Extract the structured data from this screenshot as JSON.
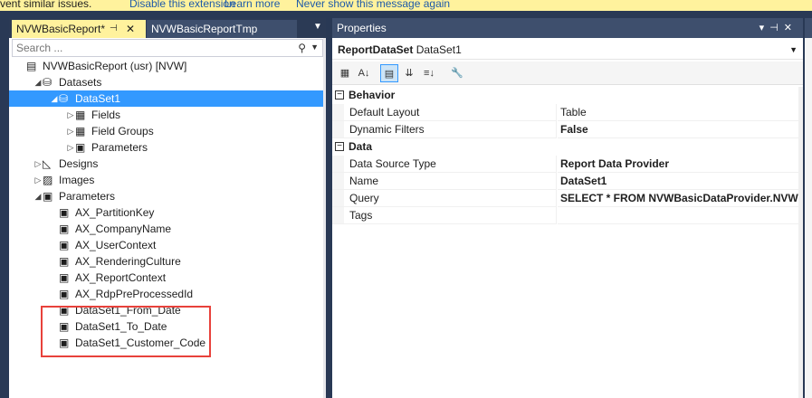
{
  "infobar": {
    "text": "vent similar issues.",
    "link1": "Disable this extension",
    "link2": "Learn more",
    "link3": "Never show this message again"
  },
  "left_panel": {
    "tabs": [
      {
        "label": "NVWBasicReport*",
        "active": true
      },
      {
        "label": "NVWBasicReportTmp",
        "active": false
      }
    ],
    "search": {
      "placeholder": "Search ..."
    },
    "tree": [
      {
        "label": "NVWBasicReport (usr) [NVW]",
        "icon": "report-icon",
        "level": 0,
        "arrow": ""
      },
      {
        "label": "Datasets",
        "icon": "datasets-icon",
        "level": 1,
        "arrow": "expanded"
      },
      {
        "label": "DataSet1",
        "icon": "dataset-icon",
        "level": 2,
        "arrow": "expanded",
        "selected": true
      },
      {
        "label": "Fields",
        "icon": "fields-icon",
        "level": 3,
        "arrow": "collapsed"
      },
      {
        "label": "Field Groups",
        "icon": "field-groups-icon",
        "level": 3,
        "arrow": "collapsed"
      },
      {
        "label": "Parameters",
        "icon": "parameters-icon",
        "level": 3,
        "arrow": "collapsed"
      },
      {
        "label": "Designs",
        "icon": "designs-icon",
        "level": 1,
        "arrow": "collapsed"
      },
      {
        "label": "Images",
        "icon": "images-icon",
        "level": 1,
        "arrow": "collapsed"
      },
      {
        "label": "Parameters",
        "icon": "parameters-icon",
        "level": 1,
        "arrow": "expanded"
      },
      {
        "label": "AX_PartitionKey",
        "icon": "parameter-icon",
        "level": 2,
        "arrow": ""
      },
      {
        "label": "AX_CompanyName",
        "icon": "parameter-icon",
        "level": 2,
        "arrow": ""
      },
      {
        "label": "AX_UserContext",
        "icon": "parameter-icon",
        "level": 2,
        "arrow": ""
      },
      {
        "label": "AX_RenderingCulture",
        "icon": "parameter-icon",
        "level": 2,
        "arrow": ""
      },
      {
        "label": "AX_ReportContext",
        "icon": "parameter-icon",
        "level": 2,
        "arrow": ""
      },
      {
        "label": "AX_RdpPreProcessedId",
        "icon": "parameter-icon",
        "level": 2,
        "arrow": ""
      },
      {
        "label": "DataSet1_From_Date",
        "icon": "parameter-icon",
        "level": 2,
        "arrow": ""
      },
      {
        "label": "DataSet1_To_Date",
        "icon": "parameter-icon",
        "level": 2,
        "arrow": ""
      },
      {
        "label": "DataSet1_Customer_Code",
        "icon": "parameter-icon",
        "level": 2,
        "arrow": ""
      }
    ]
  },
  "properties": {
    "title": "Properties",
    "object_type": "ReportDataSet",
    "object_name": "DataSet1",
    "categories": [
      {
        "name": "Behavior",
        "rows": [
          {
            "name": "Default Layout",
            "value": "Table",
            "bold": false
          },
          {
            "name": "Dynamic Filters",
            "value": "False",
            "bold": true
          }
        ]
      },
      {
        "name": "Data",
        "rows": [
          {
            "name": "Data Source Type",
            "value": "Report Data Provider",
            "bold": true
          },
          {
            "name": "Name",
            "value": "DataSet1",
            "bold": true
          },
          {
            "name": "Query",
            "value": "SELECT * FROM NVWBasicDataProvider.NVWBa",
            "bold": true
          },
          {
            "name": "Tags",
            "value": "",
            "bold": false
          }
        ]
      }
    ]
  },
  "colors": {
    "accent_selected": "#3399ff",
    "highlight_box": "#e8413b",
    "active_tab": "#fff29d",
    "frame": "#293955"
  }
}
